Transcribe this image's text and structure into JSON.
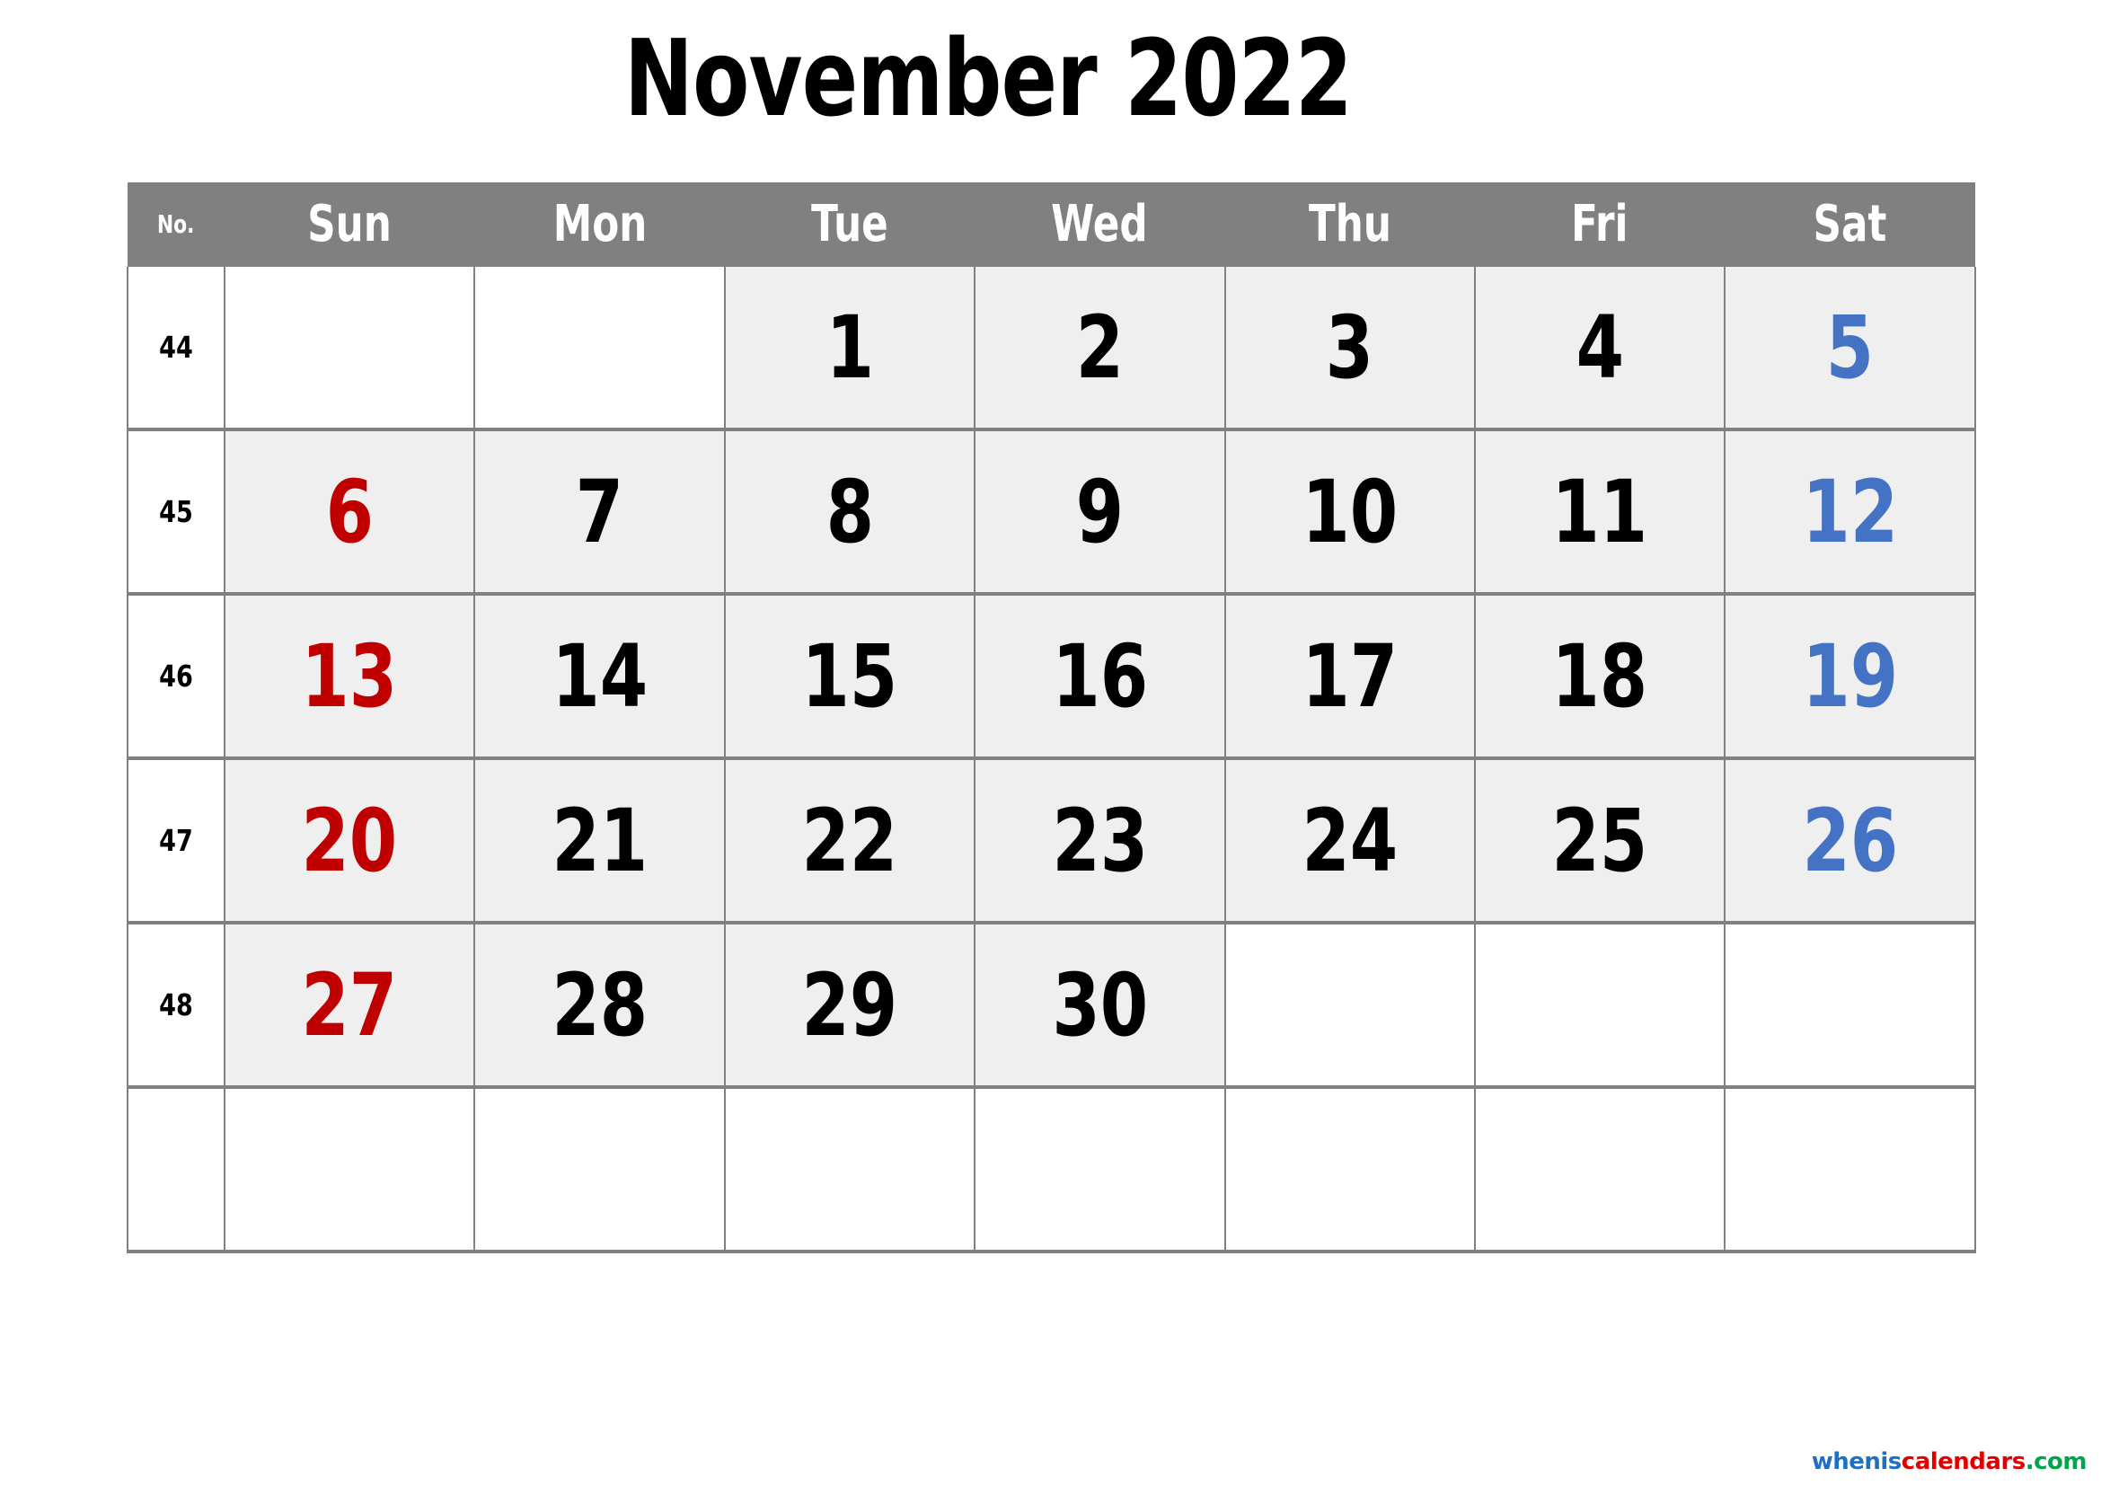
{
  "document": {
    "type": "printable-monthly-calendar",
    "title": "November 2022",
    "month": "November",
    "year": "2022"
  },
  "colors": {
    "header_background": "#808080",
    "header_text": "#ffffff",
    "grid_line": "#808080",
    "filled_cell": "#efefef",
    "empty_cell": "#ffffff",
    "sunday_text": "#C00000",
    "saturday_text": "#4472C4",
    "weekday_text": "#000000",
    "week_number_text": "#000000"
  },
  "header": {
    "week_number_label": "No.",
    "days": [
      {
        "label": "Sun"
      },
      {
        "label": "Mon"
      },
      {
        "label": "Tue"
      },
      {
        "label": "Wed"
      },
      {
        "label": "Thu"
      },
      {
        "label": "Fri"
      },
      {
        "label": "Sat"
      }
    ]
  },
  "weeks": [
    {
      "number": "44",
      "cells": [
        {
          "day": "",
          "filled": false,
          "kind": "sun"
        },
        {
          "day": "",
          "filled": false,
          "kind": "weekday"
        },
        {
          "day": "1",
          "filled": true,
          "kind": "weekday"
        },
        {
          "day": "2",
          "filled": true,
          "kind": "weekday"
        },
        {
          "day": "3",
          "filled": true,
          "kind": "weekday"
        },
        {
          "day": "4",
          "filled": true,
          "kind": "weekday"
        },
        {
          "day": "5",
          "filled": true,
          "kind": "sat"
        }
      ]
    },
    {
      "number": "45",
      "cells": [
        {
          "day": "6",
          "filled": true,
          "kind": "sun"
        },
        {
          "day": "7",
          "filled": true,
          "kind": "weekday"
        },
        {
          "day": "8",
          "filled": true,
          "kind": "weekday"
        },
        {
          "day": "9",
          "filled": true,
          "kind": "weekday"
        },
        {
          "day": "10",
          "filled": true,
          "kind": "weekday"
        },
        {
          "day": "11",
          "filled": true,
          "kind": "weekday"
        },
        {
          "day": "12",
          "filled": true,
          "kind": "sat"
        }
      ]
    },
    {
      "number": "46",
      "cells": [
        {
          "day": "13",
          "filled": true,
          "kind": "sun"
        },
        {
          "day": "14",
          "filled": true,
          "kind": "weekday"
        },
        {
          "day": "15",
          "filled": true,
          "kind": "weekday"
        },
        {
          "day": "16",
          "filled": true,
          "kind": "weekday"
        },
        {
          "day": "17",
          "filled": true,
          "kind": "weekday"
        },
        {
          "day": "18",
          "filled": true,
          "kind": "weekday"
        },
        {
          "day": "19",
          "filled": true,
          "kind": "sat"
        }
      ]
    },
    {
      "number": "47",
      "cells": [
        {
          "day": "20",
          "filled": true,
          "kind": "sun"
        },
        {
          "day": "21",
          "filled": true,
          "kind": "weekday"
        },
        {
          "day": "22",
          "filled": true,
          "kind": "weekday"
        },
        {
          "day": "23",
          "filled": true,
          "kind": "weekday"
        },
        {
          "day": "24",
          "filled": true,
          "kind": "weekday"
        },
        {
          "day": "25",
          "filled": true,
          "kind": "weekday"
        },
        {
          "day": "26",
          "filled": true,
          "kind": "sat"
        }
      ]
    },
    {
      "number": "48",
      "cells": [
        {
          "day": "27",
          "filled": true,
          "kind": "sun"
        },
        {
          "day": "28",
          "filled": true,
          "kind": "weekday"
        },
        {
          "day": "29",
          "filled": true,
          "kind": "weekday"
        },
        {
          "day": "30",
          "filled": true,
          "kind": "weekday"
        },
        {
          "day": "",
          "filled": false,
          "kind": "weekday"
        },
        {
          "day": "",
          "filled": false,
          "kind": "weekday"
        },
        {
          "day": "",
          "filled": false,
          "kind": "sat"
        }
      ]
    },
    {
      "number": "",
      "cells": [
        {
          "day": "",
          "filled": false,
          "kind": "sun"
        },
        {
          "day": "",
          "filled": false,
          "kind": "weekday"
        },
        {
          "day": "",
          "filled": false,
          "kind": "weekday"
        },
        {
          "day": "",
          "filled": false,
          "kind": "weekday"
        },
        {
          "day": "",
          "filled": false,
          "kind": "weekday"
        },
        {
          "day": "",
          "filled": false,
          "kind": "weekday"
        },
        {
          "day": "",
          "filled": false,
          "kind": "sat"
        }
      ]
    }
  ],
  "watermark": {
    "part1": "whenis",
    "part2": "calendars",
    "part3": ".com"
  }
}
